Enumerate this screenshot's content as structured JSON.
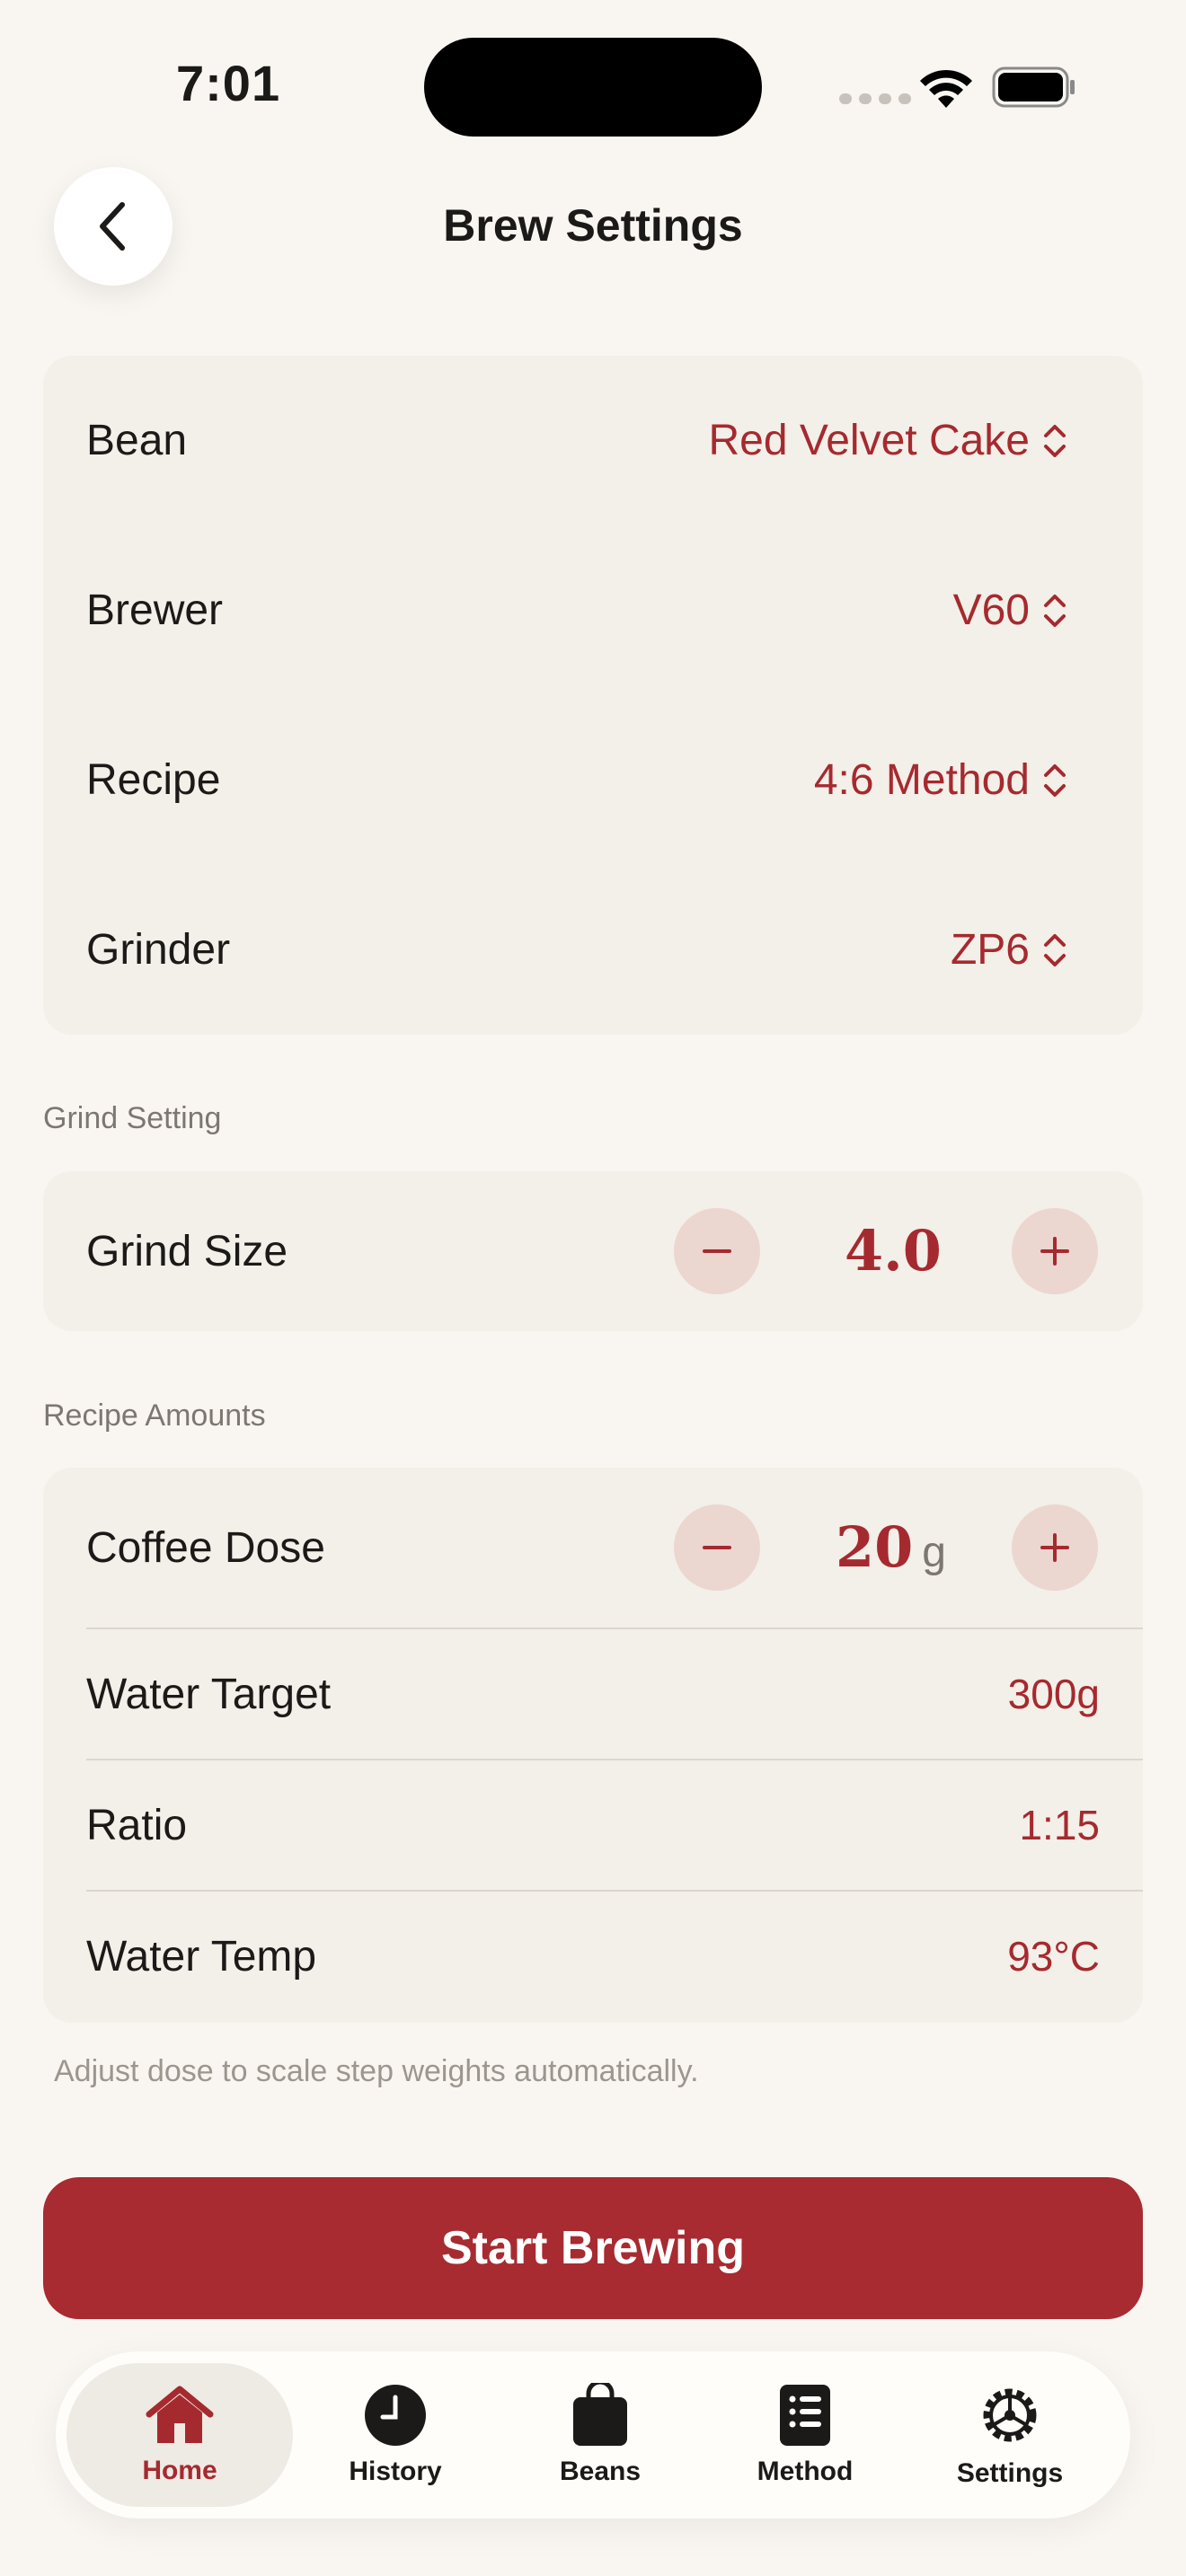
{
  "status_bar": {
    "time": "7:01"
  },
  "header": {
    "title": "Brew Settings"
  },
  "pickers": [
    {
      "label": "Bean",
      "value": "Red Velvet Cake"
    },
    {
      "label": "Brewer",
      "value": "V60"
    },
    {
      "label": "Recipe",
      "value": "4:6 Method"
    },
    {
      "label": "Grinder",
      "value": "ZP6"
    }
  ],
  "grind_section": {
    "title": "Grind Setting",
    "label": "Grind Size",
    "value": "4.0"
  },
  "amounts_section": {
    "title": "Recipe Amounts",
    "dose": {
      "label": "Coffee Dose",
      "value": "20",
      "unit": "g"
    },
    "water_target": {
      "label": "Water Target",
      "value": "300g"
    },
    "ratio": {
      "label": "Ratio",
      "value": "1:15"
    },
    "water_temp": {
      "label": "Water Temp",
      "value": "93°C"
    }
  },
  "hint": "Adjust dose to scale step weights automatically.",
  "start_button": "Start Brewing",
  "tabs": [
    {
      "label": "Home",
      "icon": "home-icon",
      "active": true
    },
    {
      "label": "History",
      "icon": "clock-icon",
      "active": false
    },
    {
      "label": "Beans",
      "icon": "bag-icon",
      "active": false
    },
    {
      "label": "Method",
      "icon": "list-icon",
      "active": false
    },
    {
      "label": "Settings",
      "icon": "gear-icon",
      "active": false
    }
  ],
  "colors": {
    "accent": "#a52a2f",
    "background": "#f9f6f1",
    "card": "#f3efe9"
  }
}
